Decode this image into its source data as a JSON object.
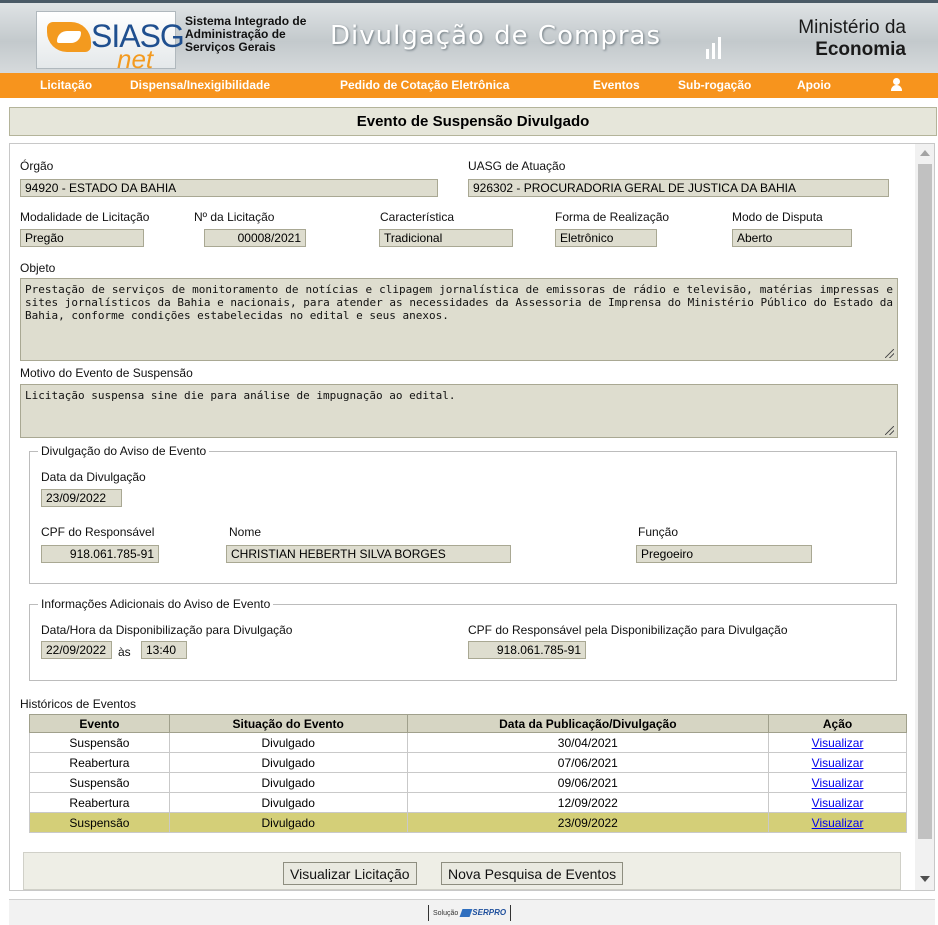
{
  "header": {
    "logo_text": "SIASG",
    "logo_sub": "net",
    "system_name": [
      "Sistema Integrado de",
      "Administração de",
      "Serviços Gerais"
    ],
    "title": "Divulgação de Compras",
    "ministry_line1": "Ministério da",
    "ministry_line2": "Economia"
  },
  "nav": {
    "items": [
      "Licitação",
      "Dispensa/Inexigibilidade",
      "Pedido de Cotação Eletrônica",
      "Eventos",
      "Sub-rogação",
      "Apoio"
    ],
    "user_icon": "user-icon"
  },
  "page": {
    "title": "Evento de Suspensão Divulgado"
  },
  "form": {
    "orgao_label": "Órgão",
    "orgao_value": "94920 - ESTADO DA BAHIA",
    "uasg_label": "UASG de Atuação",
    "uasg_value": "926302 - PROCURADORIA GERAL DE JUSTICA DA BAHIA",
    "modalidade_label": "Modalidade de Licitação",
    "modalidade_value": "Pregão",
    "numero_label": "Nº da Licitação",
    "numero_value": "00008/2021",
    "caracteristica_label": "Característica",
    "caracteristica_value": "Tradicional",
    "forma_label": "Forma de Realização",
    "forma_value": "Eletrônico",
    "modo_label": "Modo de Disputa",
    "modo_value": "Aberto",
    "objeto_label": "Objeto",
    "objeto_value": "Prestação de serviços de monitoramento de notícias e clipagem jornalística de emissoras de rádio e televisão, matérias impressas e sites jornalísticos da Bahia e nacionais, para atender as necessidades da Assessoria de Imprensa do Ministério Público do Estado da Bahia, conforme condições estabelecidas no edital e seus anexos.",
    "motivo_label": "Motivo do Evento de Suspensão",
    "motivo_value": "Licitação suspensa sine die para análise de impugnação ao edital."
  },
  "divulgacao": {
    "legend": "Divulgação do Aviso de Evento",
    "data_label": "Data da Divulgação",
    "data_value": "23/09/2022",
    "cpf_label": "CPF do Responsável",
    "cpf_value": "918.061.785-91",
    "nome_label": "Nome",
    "nome_value": "CHRISTIAN HEBERTH SILVA BORGES",
    "funcao_label": "Função",
    "funcao_value": "Pregoeiro"
  },
  "adicionais": {
    "legend": "Informações Adicionais do Aviso de Evento",
    "datahora_label": "Data/Hora da Disponibilização para Divulgação",
    "data_value": "22/09/2022",
    "as_text": "às",
    "hora_value": "13:40",
    "cpf_label": "CPF do Responsável pela Disponibilização para Divulgação",
    "cpf_value": "918.061.785-91"
  },
  "historico": {
    "title": "Históricos de Eventos",
    "columns": [
      "Evento",
      "Situação do Evento",
      "Data da Publicação/Divulgação",
      "Ação"
    ],
    "rows": [
      {
        "evento": "Suspensão",
        "situacao": "Divulgado",
        "data": "30/04/2021",
        "acao": "Visualizar"
      },
      {
        "evento": "Reabertura",
        "situacao": "Divulgado",
        "data": "07/06/2021",
        "acao": "Visualizar"
      },
      {
        "evento": "Suspensão",
        "situacao": "Divulgado",
        "data": "09/06/2021",
        "acao": "Visualizar"
      },
      {
        "evento": "Reabertura",
        "situacao": "Divulgado",
        "data": "12/09/2022",
        "acao": "Visualizar"
      },
      {
        "evento": "Suspensão",
        "situacao": "Divulgado",
        "data": "23/09/2022",
        "acao": "Visualizar"
      }
    ],
    "selected_row": 4
  },
  "buttons": {
    "visualizar": "Visualizar Licitação",
    "nova_pesquisa": "Nova Pesquisa de Eventos"
  },
  "footer": {
    "solucao": "Solução",
    "serpro": "SERPRO"
  },
  "colors": {
    "nav": "#f7941d",
    "field_bg": "#deddcf",
    "selected_row": "#d4cf78"
  }
}
